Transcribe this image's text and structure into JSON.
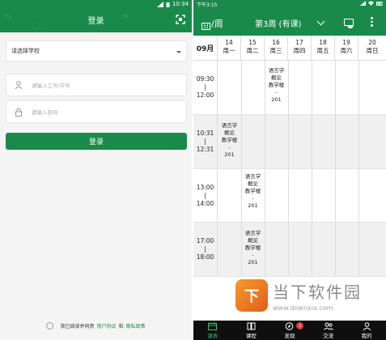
{
  "login": {
    "status_time": "10:34",
    "title": "登录",
    "school_select_placeholder": "请选择学校",
    "username_placeholder": "请输入工号/学号",
    "password_placeholder": "请输入密码",
    "login_button": "登录",
    "agreement": {
      "prefix": "我已阅读并同意",
      "user_agreement": "用户协议",
      "and": "和",
      "privacy_policy": "隐私政策"
    }
  },
  "timetable": {
    "status_time": "下午3:15",
    "week_mode_small": "日",
    "week_mode": "/周",
    "week_title": "第3周 (有课)",
    "month": "09月",
    "days": [
      {
        "date": "14",
        "weekday": "周一"
      },
      {
        "date": "15",
        "weekday": "周二"
      },
      {
        "date": "16",
        "weekday": "周三"
      },
      {
        "date": "17",
        "weekday": "周四"
      },
      {
        "date": "18",
        "weekday": "周五"
      },
      {
        "date": "19",
        "weekday": "周六"
      },
      {
        "date": "20",
        "weekday": "周日"
      }
    ],
    "slots": [
      {
        "start": "09:30",
        "sep": "|",
        "end": "12:00"
      },
      {
        "start": "10:31",
        "sep": "|",
        "end": "12:31"
      },
      {
        "start": "13:00",
        "sep": "|",
        "end": "14:00"
      },
      {
        "start": "17:00",
        "sep": "|",
        "end": "18:00"
      }
    ],
    "courses": [
      {
        "line1": "语言学",
        "line2": "概论",
        "room": "教学楼",
        "dash": "-",
        "num": "201",
        "weekday": "周三",
        "slot": "09:30-12:00"
      },
      {
        "line1": "语言学",
        "line2": "概论",
        "room": "教学楼",
        "dash": "-",
        "num": "201",
        "weekday": "周一",
        "slot": "10:31-12:31"
      },
      {
        "line1": "语言学",
        "line2": "概论",
        "room": "教学楼",
        "dash": "-",
        "num": "201",
        "weekday": "周二",
        "slot": "13:00-14:00"
      },
      {
        "line1": "语言学",
        "line2": "概论",
        "room": "教学楼",
        "dash": "-",
        "num": "201",
        "weekday": "周二",
        "slot": "17:00-18:00"
      }
    ],
    "tabs": [
      {
        "label": "课表",
        "icon": "calendar-icon",
        "active": true
      },
      {
        "label": "课程",
        "icon": "book-icon",
        "active": false
      },
      {
        "label": "发现",
        "icon": "compass-icon",
        "active": false,
        "badge": "2"
      },
      {
        "label": "交流",
        "icon": "people-icon",
        "active": false
      },
      {
        "label": "我的",
        "icon": "person-icon",
        "active": false
      }
    ],
    "watermark": {
      "logo": "下",
      "title": "当下软件园",
      "url": "www.downxia.com"
    }
  },
  "colors": {
    "primary_green": "#1a8a4a",
    "active_tab_green": "#2fbf6a",
    "alt_row_gray": "#f0f0f0",
    "badge_red": "#e53935"
  }
}
